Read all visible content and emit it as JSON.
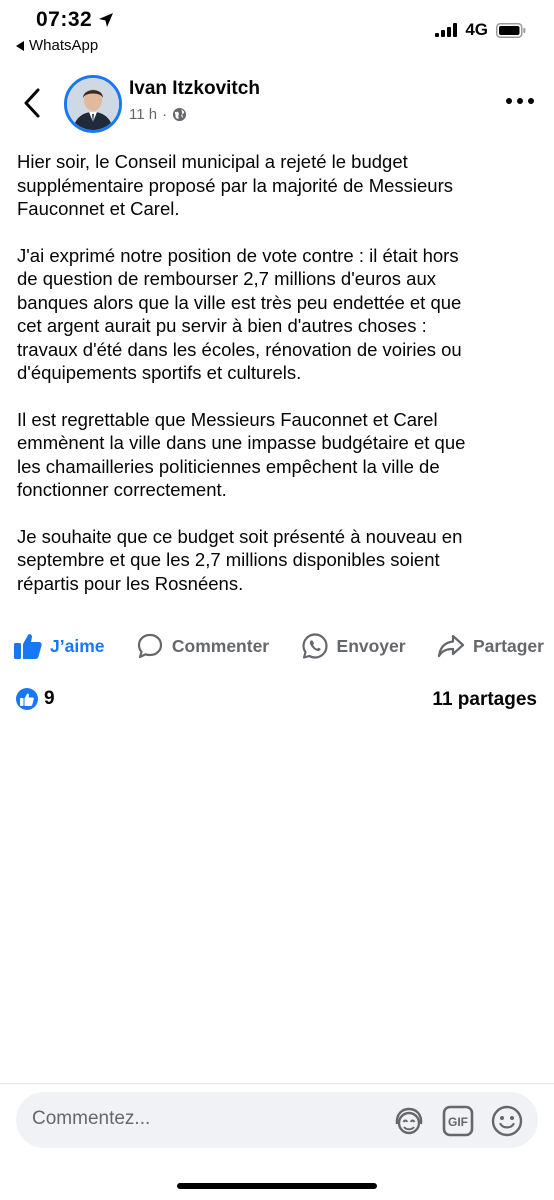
{
  "status_bar": {
    "time": "07:32",
    "back_app": "WhatsApp",
    "network": "4G"
  },
  "post": {
    "author": "Ivan Itzkovitch",
    "time_ago": "11 h",
    "separator": "·",
    "paragraphs": [
      "Hier soir, le Conseil municipal a rejeté le budget\nsupplémentaire proposé par la majorité de Messieurs\nFauconnet et Carel.",
      "J'ai exprimé notre position de vote contre : il était hors\nde question de rembourser 2,7 millions d'euros aux\nbanques alors que la ville est très peu endettée et que\ncet argent aurait pu servir à bien d'autres choses :\ntravaux d'été dans les écoles, rénovation de voiries ou\nd'équipements sportifs et culturels.",
      "Il est regrettable que Messieurs Fauconnet et Carel\nemmènent la ville dans une impasse budgétaire et que\nles chamailleries politiciennes empêchent la ville de\nfonctionner correctement.",
      "Je souhaite que ce budget soit présenté à nouveau en\nseptembre et que les 2,7 millions disponibles soient\nrépartis pour les Rosnéens."
    ]
  },
  "actions": {
    "like": "J’aime",
    "comment": "Commenter",
    "send": "Envoyer",
    "share": "Partager"
  },
  "stats": {
    "reactions": "9",
    "shares": "11 partages"
  },
  "composer": {
    "placeholder": "Commentez..."
  },
  "colors": {
    "accent": "#1877f2",
    "muted": "#65676b"
  }
}
